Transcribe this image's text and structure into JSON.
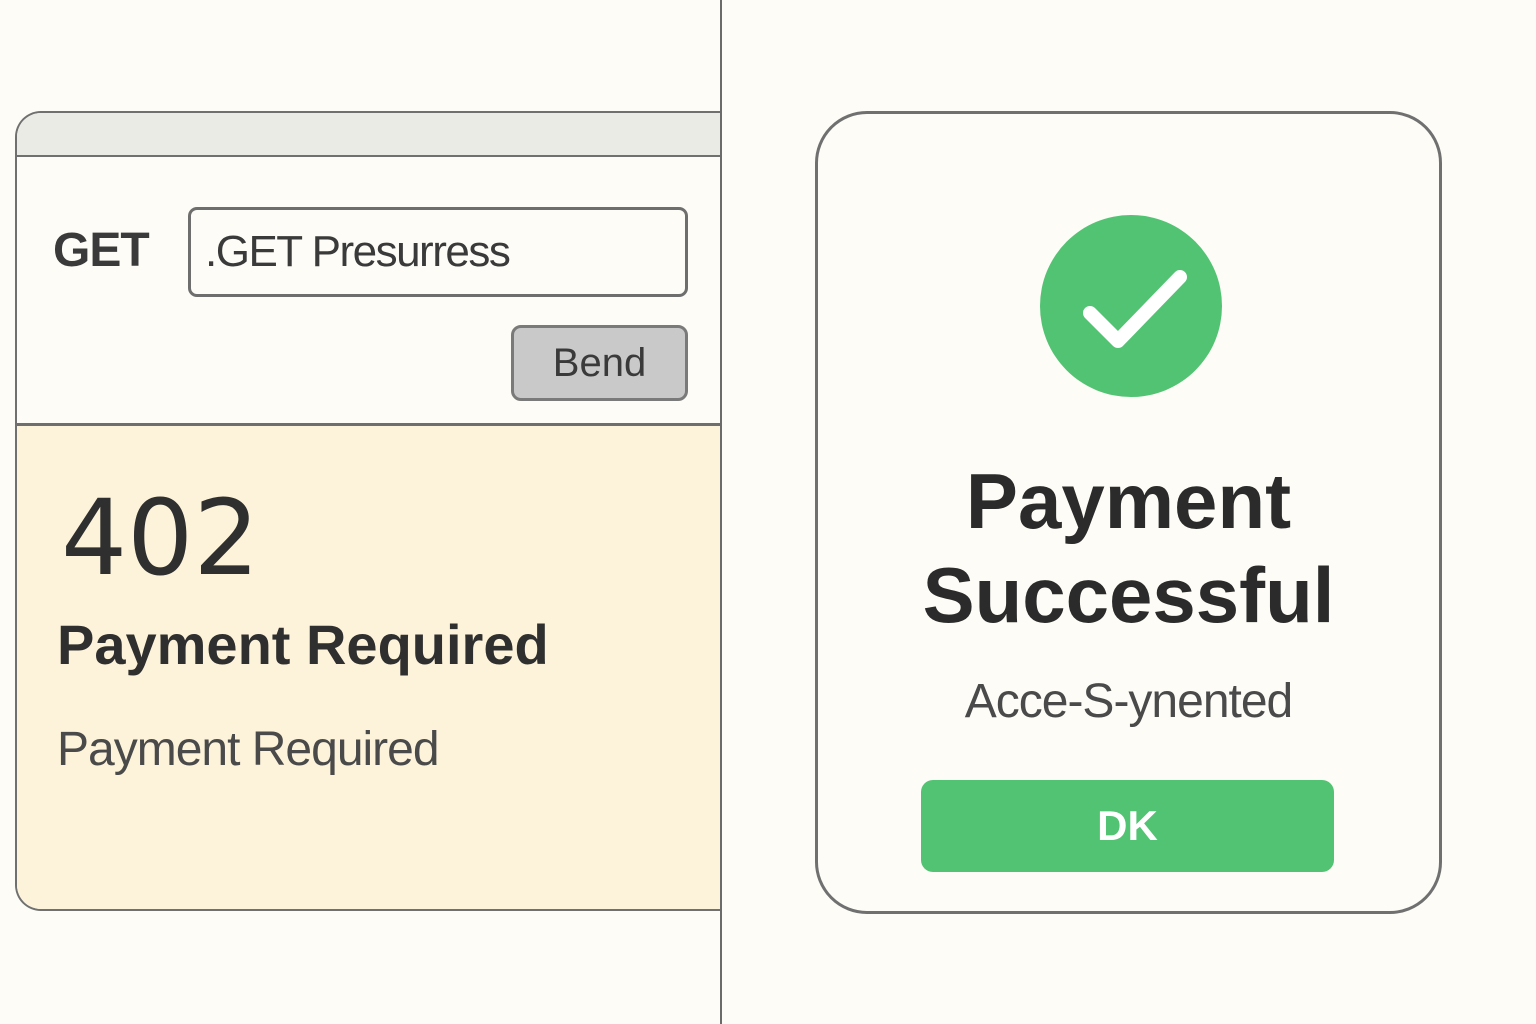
{
  "request_panel": {
    "method": "GET",
    "url_value": ".GET Presurress",
    "send_label": "Bend"
  },
  "response": {
    "status_code": "402",
    "status_title": "Payment Required",
    "message": "Payment Required"
  },
  "success_dialog": {
    "icon": "checkmark-circle-icon",
    "title": "Payment Successful",
    "subtitle": "Acce-S-ynented",
    "ok_label": "DK"
  },
  "colors": {
    "background": "#fdfcf6",
    "response_background": "#fdf3da",
    "success_green": "#52c373",
    "button_gray": "#c9c9c9",
    "border": "#707070",
    "text_dark": "#2f2f2f"
  }
}
